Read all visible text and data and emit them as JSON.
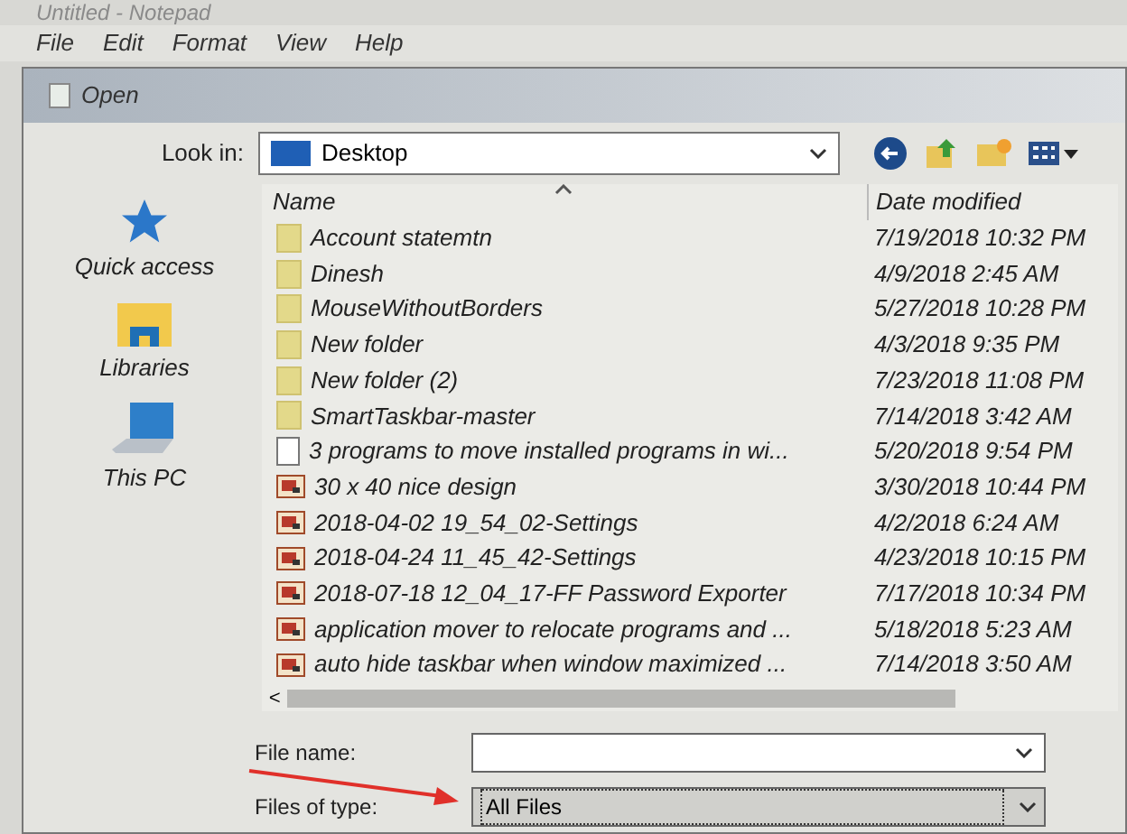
{
  "window": {
    "title": "Untitled - Notepad"
  },
  "menu": [
    "File",
    "Edit",
    "Format",
    "View",
    "Help"
  ],
  "dialog": {
    "title": "Open",
    "look_in": {
      "label": "Look in:",
      "value": "Desktop"
    },
    "places": [
      {
        "label": "Quick access",
        "kind": "star"
      },
      {
        "label": "Libraries",
        "kind": "library"
      },
      {
        "label": "This PC",
        "kind": "pc"
      }
    ],
    "table": {
      "columns": [
        "Name",
        "Date modified"
      ],
      "rows": [
        {
          "name": "Account statemtn",
          "date": "7/19/2018 10:32 PM",
          "kind": "folder"
        },
        {
          "name": "Dinesh",
          "date": "4/9/2018 2:45 AM",
          "kind": "folder"
        },
        {
          "name": "MouseWithoutBorders",
          "date": "5/27/2018 10:28 PM",
          "kind": "folder"
        },
        {
          "name": "New folder",
          "date": "4/3/2018 9:35 PM",
          "kind": "folder"
        },
        {
          "name": "New folder (2)",
          "date": "7/23/2018 11:08 PM",
          "kind": "folder"
        },
        {
          "name": "SmartTaskbar-master",
          "date": "7/14/2018 3:42 AM",
          "kind": "folder"
        },
        {
          "name": "3 programs to move installed programs in wi...",
          "date": "5/20/2018 9:54 PM",
          "kind": "document"
        },
        {
          "name": "30 x 40 nice design",
          "date": "3/30/2018 10:44 PM",
          "kind": "image"
        },
        {
          "name": "2018-04-02 19_54_02-Settings",
          "date": "4/2/2018 6:24 AM",
          "kind": "image"
        },
        {
          "name": "2018-04-24 11_45_42-Settings",
          "date": "4/23/2018 10:15 PM",
          "kind": "image"
        },
        {
          "name": "2018-07-18 12_04_17-FF Password Exporter",
          "date": "7/17/2018 10:34 PM",
          "kind": "image"
        },
        {
          "name": "application mover to relocate programs and ...",
          "date": "5/18/2018 5:23 AM",
          "kind": "image"
        },
        {
          "name": "auto hide taskbar when window maximized ...",
          "date": "7/14/2018 3:50 AM",
          "kind": "image"
        }
      ]
    },
    "scroll_left": "<",
    "file_name": {
      "label": "File name:"
    },
    "file_type": {
      "label": "Files of type:",
      "value": "All Files"
    }
  }
}
